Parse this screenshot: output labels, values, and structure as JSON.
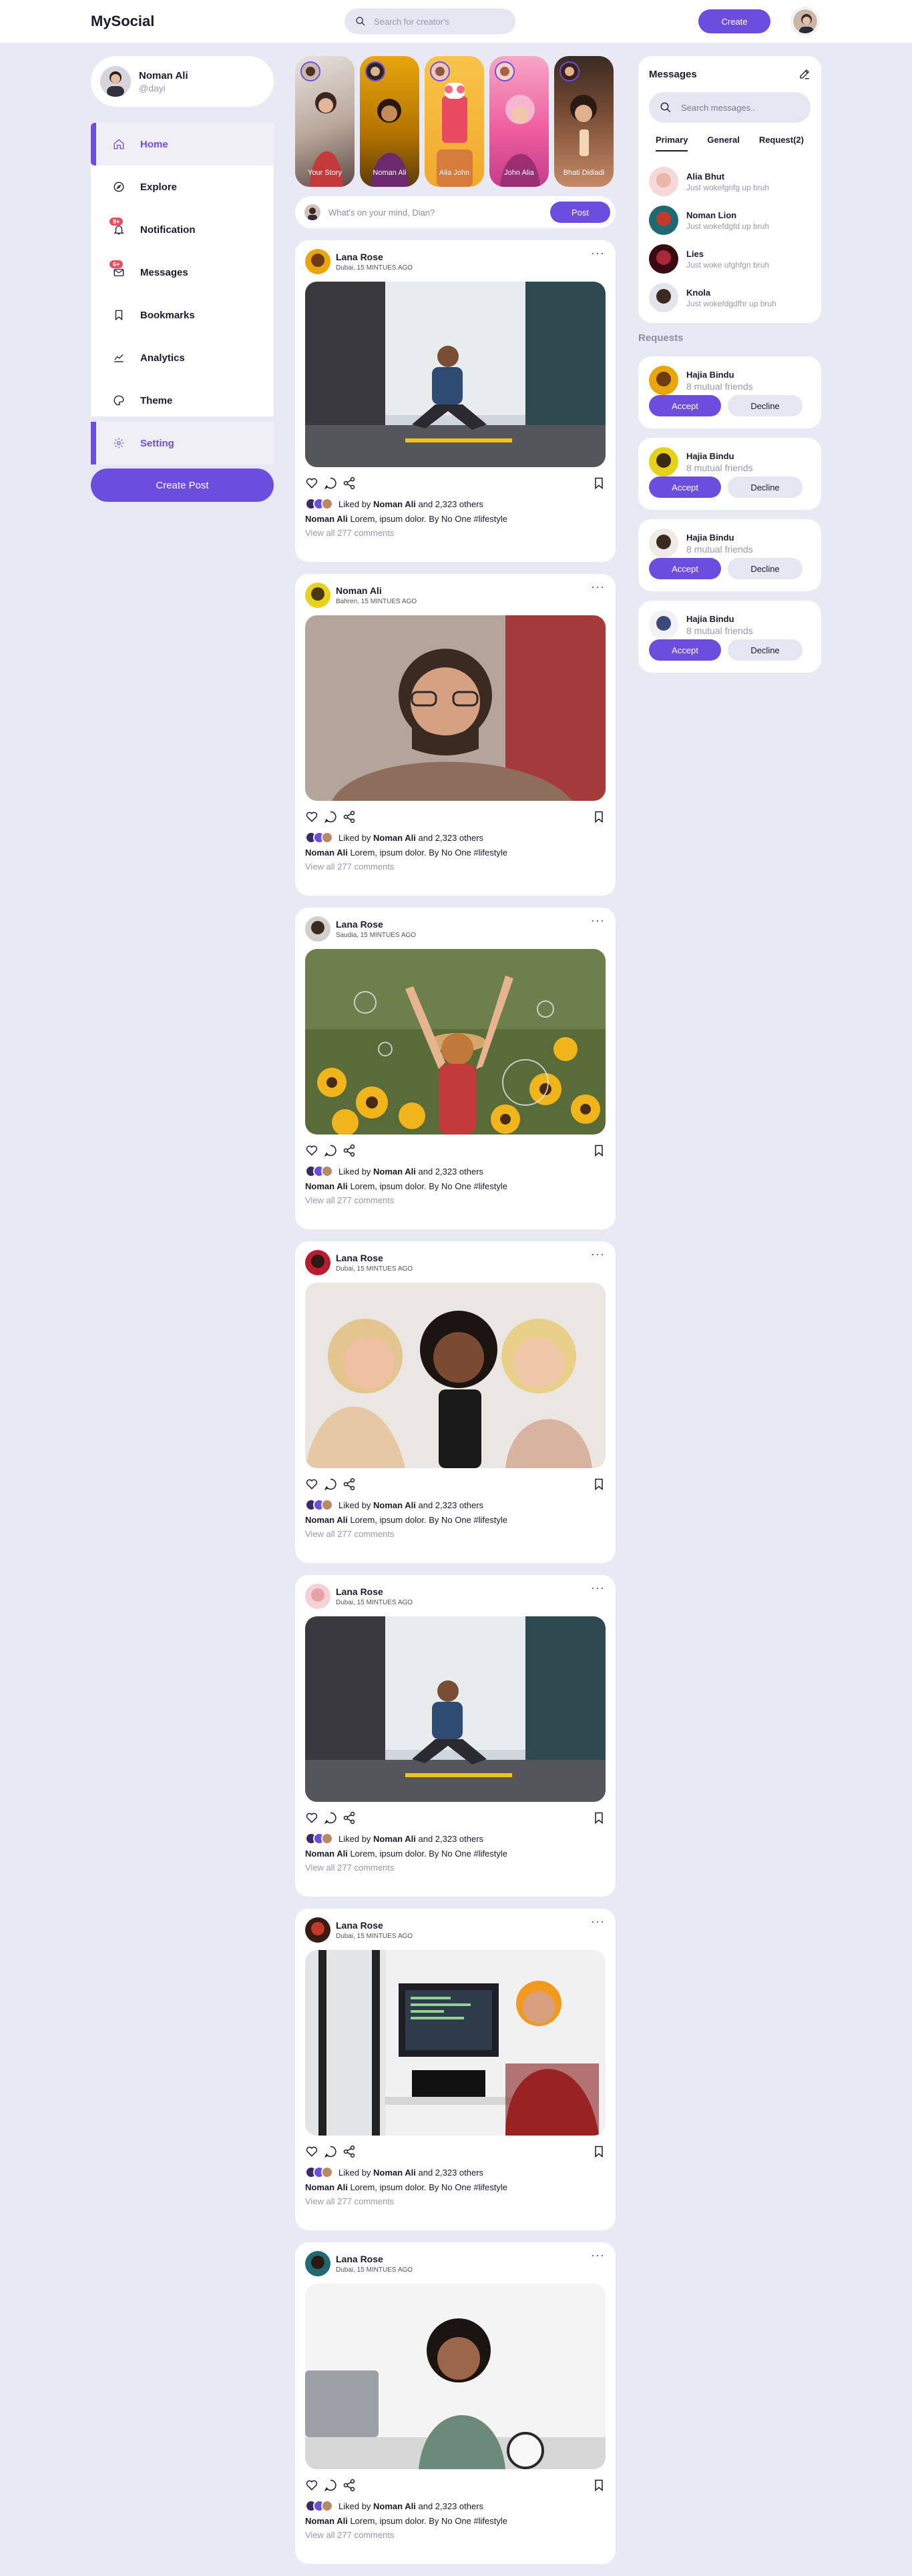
{
  "header": {
    "logo": "MySocial",
    "search_placeholder": "Search for creator's",
    "create_label": "Create"
  },
  "profile": {
    "name": "Noman Ali",
    "handle": "@dayi"
  },
  "sidebar": {
    "items": [
      {
        "label": "Home",
        "icon": "home-icon",
        "active": true
      },
      {
        "label": "Explore",
        "icon": "compass-icon"
      },
      {
        "label": "Notification",
        "icon": "bell-icon",
        "badge": "9+"
      },
      {
        "label": "Messages",
        "icon": "mail-icon",
        "badge": "6+"
      },
      {
        "label": "Bookmarks",
        "icon": "bookmark-icon"
      },
      {
        "label": "Analytics",
        "icon": "chart-icon"
      },
      {
        "label": "Theme",
        "icon": "palette-icon"
      },
      {
        "label": "Setting",
        "icon": "gear-icon",
        "active": true
      }
    ],
    "create_post_label": "Create Post"
  },
  "stories": [
    {
      "label": "Your Story"
    },
    {
      "label": "Noman Ali"
    },
    {
      "label": "Alia John"
    },
    {
      "label": "John Alia"
    },
    {
      "label": "Bhati Didiadi"
    }
  ],
  "composer": {
    "placeholder": "What's on your mind, Dian?",
    "post_label": "Post"
  },
  "posts": [
    {
      "author": "Lana Rose",
      "meta": "Dubai, 15 MINTUES AGO",
      "liked_by": "Noman Ali",
      "liked_rest": "and 2,323 others",
      "cap_author": "Noman Ali",
      "caption": "Lorem, ipsum dolor. By No One #lifestyle",
      "comments": "View all 277 comments"
    },
    {
      "author": "Noman Ali",
      "meta": "Bahren, 15 MINTUES AGO",
      "liked_by": "Noman Ali",
      "liked_rest": "and 2,323 others",
      "cap_author": "Noman Ali",
      "caption": "Lorem, ipsum dolor. By No One #lifestyle",
      "comments": "View all 277 comments"
    },
    {
      "author": "Lana Rose",
      "meta": "Saudia, 15 MINTUES AGO",
      "liked_by": "Noman Ali",
      "liked_rest": "and 2,323 others",
      "cap_author": "Noman Ali",
      "caption": "Lorem, ipsum dolor. By No One #lifestyle",
      "comments": "View all 277 comments"
    },
    {
      "author": "Lana Rose",
      "meta": "Dubai, 15 MINTUES AGO",
      "liked_by": "Noman Ali",
      "liked_rest": "and 2,323 others",
      "cap_author": "Noman Ali",
      "caption": "Lorem, ipsum dolor. By No One #lifestyle",
      "comments": "View all 277 comments"
    },
    {
      "author": "Lana Rose",
      "meta": "Dubai, 15 MINTUES AGO",
      "liked_by": "Noman Ali",
      "liked_rest": "and 2,323 others",
      "cap_author": "Noman Ali",
      "caption": "Lorem, ipsum dolor. By No One #lifestyle",
      "comments": "View all 277 comments"
    },
    {
      "author": "Lana Rose",
      "meta": "Dubai, 15 MINTUES AGO",
      "liked_by": "Noman Ali",
      "liked_rest": "and 2,323 others",
      "cap_author": "Noman Ali",
      "caption": "Lorem, ipsum dolor. By No One #lifestyle",
      "comments": "View all 277 comments"
    },
    {
      "author": "Lana Rose",
      "meta": "Dubai, 15 MINTUES AGO",
      "liked_by": "Noman Ali",
      "liked_rest": "and 2,323 others",
      "cap_author": "Noman Ali",
      "caption": "Lorem, ipsum dolor. By No One #lifestyle",
      "comments": "View all 277 comments"
    }
  ],
  "messages": {
    "title": "Messages",
    "search_placeholder": "Search messages..",
    "tabs": [
      "Primary",
      "General",
      "Request(2)"
    ],
    "items": [
      {
        "name": "Alia Bhut",
        "text": "Just wokefgnfg up bruh"
      },
      {
        "name": "Noman Lion",
        "text": "Just wokefdgfd up bruh"
      },
      {
        "name": "Lies",
        "text": "Just woke ufghfgn bruh"
      },
      {
        "name": "Knola",
        "text": "Just wokefdgdfhr up bruh"
      }
    ]
  },
  "requests": {
    "title": "Requests",
    "items": [
      {
        "name": "Hajia Bindu",
        "mutual": "8 mutual friends",
        "accept": "Accept",
        "decline": "Decline"
      },
      {
        "name": "Hajia Bindu",
        "mutual": "8 mutual friends",
        "accept": "Accept",
        "decline": "Decline"
      },
      {
        "name": "Hajia Bindu",
        "mutual": "8 mutual friends",
        "accept": "Accept",
        "decline": "Decline"
      },
      {
        "name": "Hajia Bindu",
        "mutual": "8 mutual friends",
        "accept": "Accept",
        "decline": "Decline"
      }
    ]
  },
  "colors": {
    "accent": "#6c4edf",
    "background": "#e9e8f5",
    "badge": "#ea4b5e"
  }
}
